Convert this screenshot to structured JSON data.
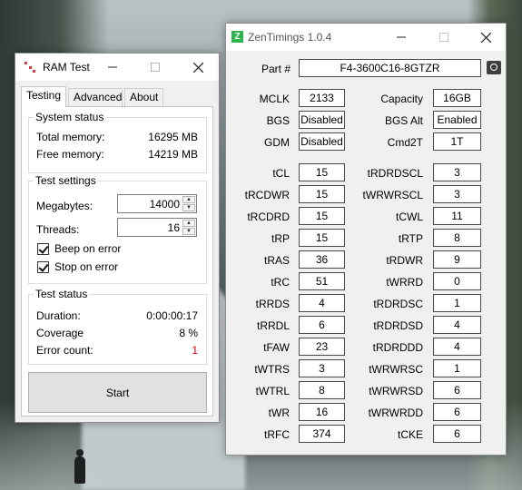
{
  "ramtest": {
    "title": "RAM Test",
    "tabs": [
      "Testing",
      "Advanced",
      "About"
    ],
    "system_status": {
      "legend": "System status",
      "total_label": "Total memory:",
      "total_value": "16295 MB",
      "free_label": "Free memory:",
      "free_value": "14219 MB"
    },
    "test_settings": {
      "legend": "Test settings",
      "megabytes_label": "Megabytes:",
      "megabytes_value": "14000",
      "threads_label": "Threads:",
      "threads_value": "16",
      "beep_label": "Beep on error",
      "beep_checked": true,
      "stop_label": "Stop on error",
      "stop_checked": true
    },
    "test_status": {
      "legend": "Test status",
      "duration_label": "Duration:",
      "duration_value": "0:00:00:17",
      "coverage_label": "Coverage",
      "coverage_value": "8 %",
      "errors_label": "Error count:",
      "errors_value": "1"
    },
    "start_label": "Start"
  },
  "zen": {
    "title": "ZenTimings 1.0.4",
    "logo_letter": "Z",
    "part_label": "Part #",
    "part_value": "F4-3600C16-8GTZR",
    "top": [
      {
        "label": "MCLK",
        "value": "2133",
        "label2": "Capacity",
        "value2": "16GB"
      },
      {
        "label": "BGS",
        "value": "Disabled",
        "label2": "BGS Alt",
        "value2": "Enabled"
      },
      {
        "label": "GDM",
        "value": "Disabled",
        "label2": "Cmd2T",
        "value2": "1T"
      }
    ],
    "timings": [
      {
        "label": "tCL",
        "value": "15",
        "label2": "tRDRDSCL",
        "value2": "3"
      },
      {
        "label": "tRCDWR",
        "value": "15",
        "label2": "tWRWRSCL",
        "value2": "3"
      },
      {
        "label": "tRCDRD",
        "value": "15",
        "label2": "tCWL",
        "value2": "11"
      },
      {
        "label": "tRP",
        "value": "15",
        "label2": "tRTP",
        "value2": "8"
      },
      {
        "label": "tRAS",
        "value": "36",
        "label2": "tRDWR",
        "value2": "9"
      },
      {
        "label": "tRC",
        "value": "51",
        "label2": "tWRRD",
        "value2": "0"
      },
      {
        "label": "tRRDS",
        "value": "4",
        "label2": "tRDRDSC",
        "value2": "1"
      },
      {
        "label": "tRRDL",
        "value": "6",
        "label2": "tRDRDSD",
        "value2": "4"
      },
      {
        "label": "tFAW",
        "value": "23",
        "label2": "tRDRDDD",
        "value2": "4"
      },
      {
        "label": "tWTRS",
        "value": "3",
        "label2": "tWRWRSC",
        "value2": "1"
      },
      {
        "label": "tWTRL",
        "value": "8",
        "label2": "tWRWRSD",
        "value2": "6"
      },
      {
        "label": "tWR",
        "value": "16",
        "label2": "tWRWRDD",
        "value2": "6"
      },
      {
        "label": "tRFC",
        "value": "374",
        "label2": "tCKE",
        "value2": "6"
      }
    ]
  },
  "icons": {
    "minimize": "minimize-icon",
    "maximize": "maximize-icon",
    "close": "close-icon",
    "screenshot": "camera-icon"
  },
  "colors": {
    "error_count": "#d00000",
    "zen_logo": "#2db54b",
    "ram_logo": "#d23b3b"
  }
}
